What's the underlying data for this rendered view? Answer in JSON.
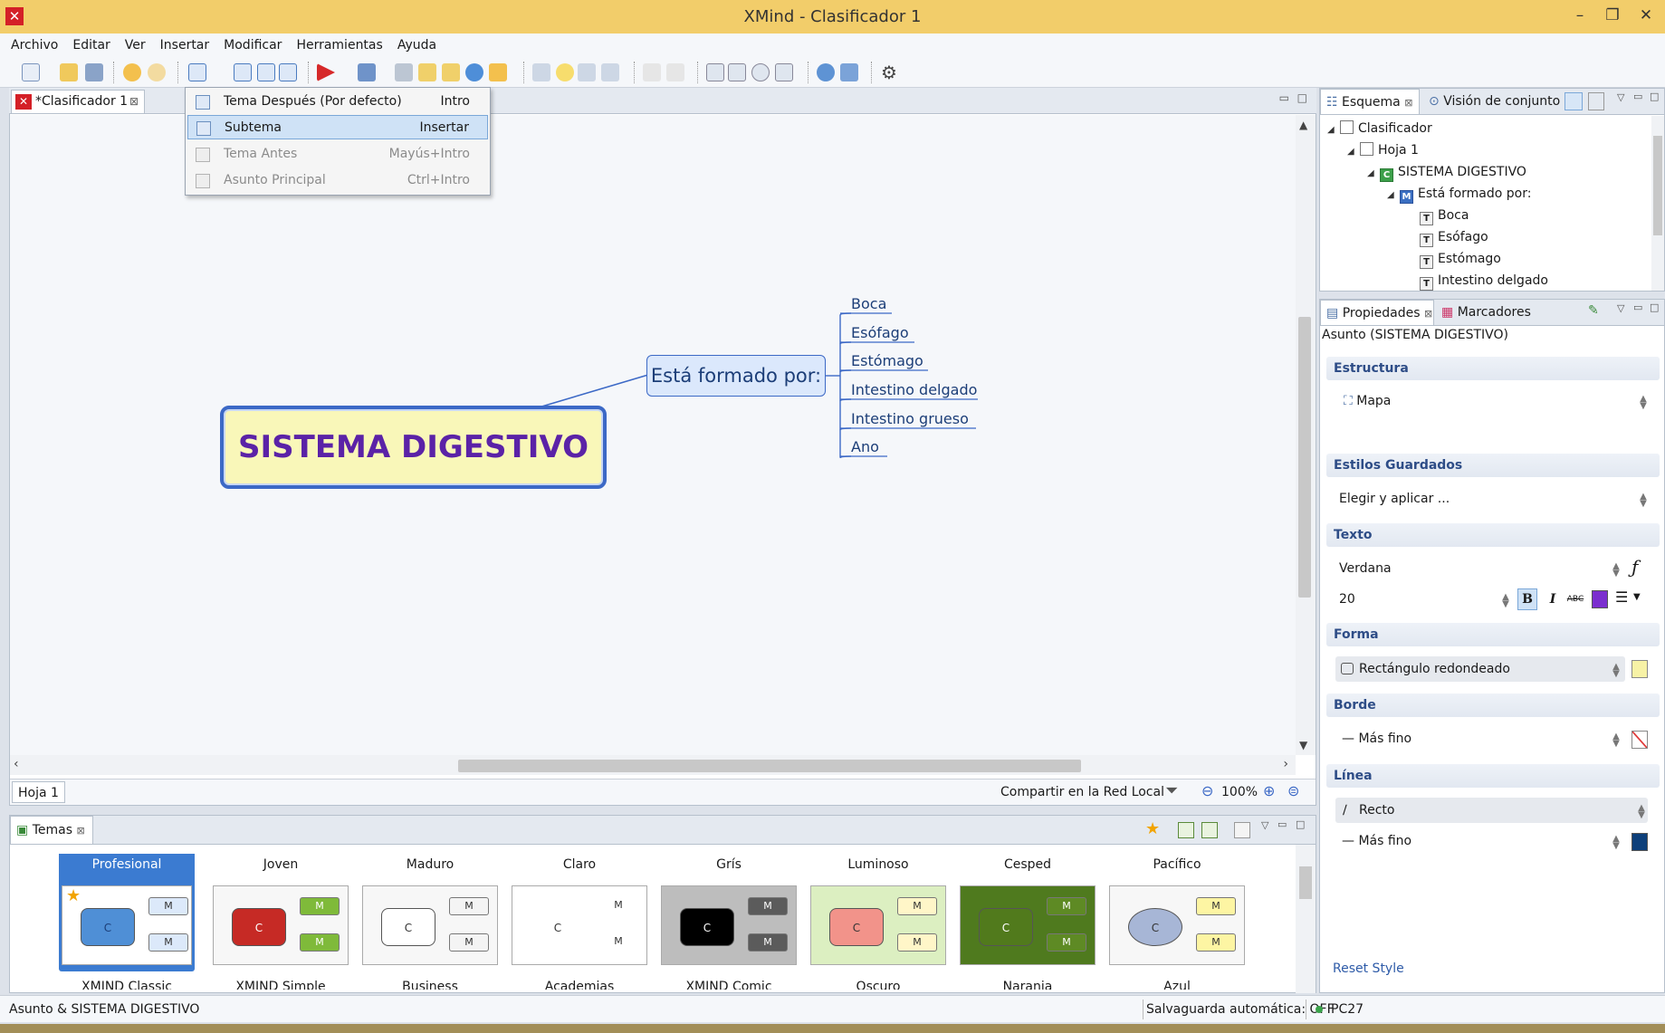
{
  "window": {
    "title": "XMind - Clasificador 1",
    "controls": [
      "–",
      "❐",
      "✕"
    ]
  },
  "menu": [
    "Archivo",
    "Editar",
    "Ver",
    "Insertar",
    "Modificar",
    "Herramientas",
    "Ayuda"
  ],
  "editor": {
    "tab_label": "*Clasificador 1",
    "sheet_tab": "Hoja 1",
    "share_label": "Compartir en la Red Local",
    "zoom": "100%"
  },
  "dropdown": {
    "items": [
      {
        "label": "Tema Después (Por defecto)",
        "shortcut": "Intro",
        "state": "enabled"
      },
      {
        "label": "Subtema",
        "shortcut": "Insertar",
        "state": "selected"
      },
      {
        "label": "Tema Antes",
        "shortcut": "Mayús+Intro",
        "state": "disabled"
      },
      {
        "label": "Asunto Principal",
        "shortcut": "Ctrl+Intro",
        "state": "disabled"
      }
    ]
  },
  "mindmap": {
    "central": "SISTEMA DIGESTIVO",
    "main_topic": "Está formado por:",
    "subtopics": [
      "Boca",
      "Esófago",
      "Estómago",
      "Intestino delgado",
      "Intestino grueso",
      "Ano"
    ]
  },
  "outline": {
    "tabs": [
      "Esquema",
      "Visión de conjunto"
    ],
    "tree": [
      {
        "label": "Clasificador",
        "icon": "workbook-icon"
      },
      {
        "label": "Hoja 1",
        "icon": "sheet-icon"
      },
      {
        "label": "SISTEMA DIGESTIVO",
        "icon": "C"
      },
      {
        "label": "Está formado por:",
        "icon": "M"
      },
      {
        "label": "Boca",
        "icon": "T"
      },
      {
        "label": "Esófago",
        "icon": "T"
      },
      {
        "label": "Estómago",
        "icon": "T"
      },
      {
        "label": "Intestino delgado",
        "icon": "T"
      }
    ]
  },
  "properties": {
    "tabs": [
      "Propiedades",
      "Marcadores"
    ],
    "subject": "Asunto (SISTEMA DIGESTIVO)",
    "sections": {
      "estructura": "Estructura",
      "estilos": "Estilos Guardados",
      "texto": "Texto",
      "forma": "Forma",
      "borde": "Borde",
      "linea": "Línea"
    },
    "estructura_value": "Mapa",
    "estilos_value": "Elegir y aplicar ...",
    "font_family": "Verdana",
    "font_size": "20",
    "bold": "B",
    "italic": "I",
    "strike": "ABC",
    "text_color": "#7b2fcf",
    "shape_value": "Rectángulo redondeado",
    "shape_fill": "#f7f2a6",
    "border_value": "Más fino",
    "line_shape": "Recto",
    "line_width": "Más fino",
    "line_color": "#0d3f7a",
    "reset": "Reset Style"
  },
  "temas": {
    "tab": "Temas",
    "themes": [
      {
        "name": "Profesional",
        "sub": "XMIND Classic",
        "c_bg": "#4f8fd6",
        "c_fg": "#1b3e78",
        "m_bg": "#dce9fa",
        "prev_bg": "#ffffff"
      },
      {
        "name": "Joven",
        "sub": "XMIND Simple",
        "c_bg": "#c62a25",
        "c_fg": "#ffffff",
        "m_bg": "#7fba3a",
        "prev_bg": "#f7f7f7"
      },
      {
        "name": "Maduro",
        "sub": "Business",
        "c_bg": "#ffffff",
        "c_fg": "#333333",
        "m_bg": "#f4f4f4",
        "prev_bg": "#f7f7f7"
      },
      {
        "name": "Claro",
        "sub": "Academias",
        "c_bg": "#ffffff",
        "c_fg": "#333333",
        "m_bg": "#ffffff",
        "prev_bg": "#ffffff"
      },
      {
        "name": "Grís",
        "sub": "XMIND Comic",
        "c_bg": "#000000",
        "c_fg": "#ffffff",
        "m_bg": "#5b5b5b",
        "prev_bg": "#bdbdbd"
      },
      {
        "name": "Luminoso",
        "sub": "Oscuro",
        "c_bg": "#f2938a",
        "c_fg": "#333333",
        "m_bg": "#fff6c8",
        "prev_bg": "#dcefc1"
      },
      {
        "name": "Cesped",
        "sub": "Naranja",
        "c_bg": "#517a1c",
        "c_fg": "#ffffff",
        "m_bg": "#5e8a24",
        "prev_bg": "#4f7a1e"
      },
      {
        "name": "Pacífico",
        "sub": "Azul",
        "c_bg": "#a7b6d6",
        "c_fg": "#333333",
        "m_bg": "#fdf5a3",
        "prev_bg": "#f7f7f7"
      }
    ]
  },
  "status": {
    "left": "Asunto & SISTEMA DIGESTIVO",
    "autosave": "Salvaguarda automática: OFF",
    "user": "PC27"
  },
  "colors": {
    "titlebar": "#f2cd6a",
    "accent": "#3c69c6",
    "topic_text": "#5b22a7"
  }
}
